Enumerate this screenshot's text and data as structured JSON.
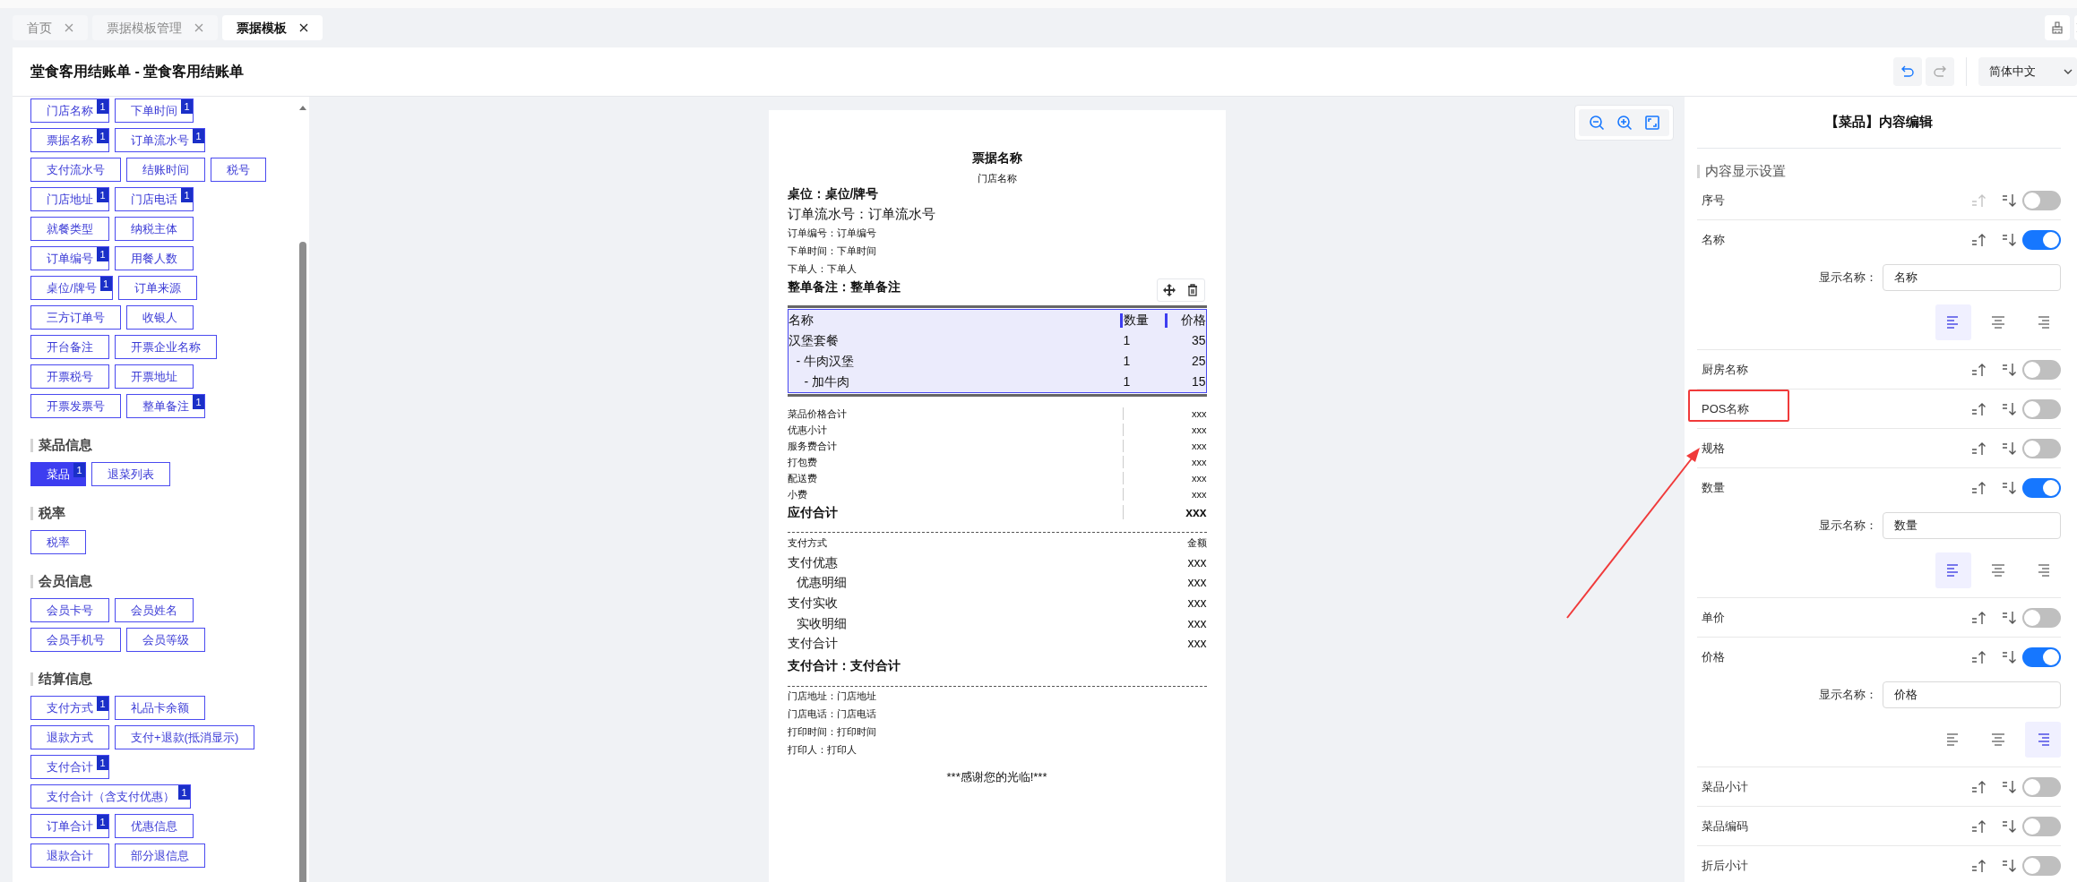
{
  "tabs": [
    {
      "label": "首页",
      "selected": false
    },
    {
      "label": "票据模板管理",
      "selected": false
    },
    {
      "label": "票据模板",
      "selected": true
    }
  ],
  "header": {
    "title": "堂食客用结账单 - 堂食客用结账单",
    "undo": {
      "disabled": false
    },
    "redo": {
      "disabled": true
    },
    "language": "简体中文"
  },
  "tag_groups": [
    {
      "rows": [
        [
          {
            "label": "门店名称",
            "badge": "1",
            "selected": false
          },
          {
            "label": "下单时间",
            "badge": "1",
            "selected": false
          }
        ],
        [
          {
            "label": "票据名称",
            "badge": "1",
            "selected": false
          },
          {
            "label": "订单流水号",
            "badge": "1",
            "selected": false
          }
        ],
        [
          {
            "label": "支付流水号",
            "selected": false
          },
          {
            "label": "结账时间",
            "selected": false
          },
          {
            "label": "税号",
            "selected": false
          }
        ],
        [
          {
            "label": "门店地址",
            "badge": "1",
            "selected": false
          },
          {
            "label": "门店电话",
            "badge": "1",
            "selected": false
          }
        ],
        [
          {
            "label": "就餐类型",
            "selected": false
          },
          {
            "label": "纳税主体",
            "selected": false
          }
        ],
        [
          {
            "label": "订单编号",
            "badge": "1",
            "selected": false
          },
          {
            "label": "用餐人数",
            "selected": false
          }
        ],
        [
          {
            "label": "桌位/牌号",
            "badge": "1",
            "selected": false
          },
          {
            "label": "订单来源",
            "selected": false
          }
        ],
        [
          {
            "label": "三方订单号",
            "selected": false
          },
          {
            "label": "收银人",
            "selected": false
          }
        ],
        [
          {
            "label": "开台备注",
            "selected": false
          },
          {
            "label": "开票企业名称",
            "selected": false
          }
        ],
        [
          {
            "label": "开票税号",
            "selected": false
          },
          {
            "label": "开票地址",
            "selected": false
          }
        ],
        [
          {
            "label": "开票发票号",
            "selected": false
          },
          {
            "label": "整单备注",
            "badge": "1",
            "selected": false
          }
        ]
      ]
    },
    {
      "title": "菜品信息",
      "rows": [
        [
          {
            "label": "菜品",
            "badge": "1",
            "selected": true
          },
          {
            "label": "退菜列表",
            "selected": false
          }
        ]
      ]
    },
    {
      "title": "税率",
      "rows": [
        [
          {
            "label": "税率",
            "selected": false
          }
        ]
      ]
    },
    {
      "title": "会员信息",
      "rows": [
        [
          {
            "label": "会员卡号",
            "selected": false
          },
          {
            "label": "会员姓名",
            "selected": false
          }
        ],
        [
          {
            "label": "会员手机号",
            "selected": false
          },
          {
            "label": "会员等级",
            "selected": false
          }
        ]
      ]
    },
    {
      "title": "结算信息",
      "rows": [
        [
          {
            "label": "支付方式",
            "badge": "1",
            "selected": false
          },
          {
            "label": "礼品卡余额",
            "selected": false
          }
        ],
        [
          {
            "label": "退款方式",
            "selected": false
          },
          {
            "label": "支付+退款(抵消显示)",
            "selected": false
          }
        ],
        [
          {
            "label": "支付合计",
            "badge": "1",
            "selected": false
          }
        ],
        [
          {
            "label": "支付合计（含支付优惠）",
            "badge": "1",
            "selected": false
          }
        ],
        [
          {
            "label": "订单合计",
            "badge": "1",
            "selected": false
          },
          {
            "label": "优惠信息",
            "selected": false
          }
        ],
        [
          {
            "label": "退款合计",
            "selected": false
          },
          {
            "label": "部分退信息",
            "selected": false
          }
        ]
      ]
    }
  ],
  "receipt": {
    "title": "票据名称",
    "store_name": "门店名称",
    "header_lines": [
      {
        "text": "桌位：桌位/牌号",
        "kind": "bold"
      },
      {
        "text": "订单流水号：订单流水号",
        "kind": "large"
      },
      {
        "text": "订单编号：订单编号",
        "kind": "small"
      },
      {
        "text": "下单时间：下单时间",
        "kind": "small"
      },
      {
        "text": "下单人：下单人",
        "kind": "small"
      },
      {
        "text": "整单备注：整单备注",
        "kind": "bold"
      }
    ],
    "dish_table": {
      "selected": true,
      "columns": [
        "名称",
        "数量",
        "价格"
      ],
      "rows": [
        {
          "name": "汉堡套餐",
          "qty": "1",
          "price": "35",
          "children": [
            {
              "name": "- 牛肉汉堡",
              "qty": "1",
              "price": "25",
              "children": [
                {
                  "name": "- 加牛肉",
                  "qty": "1",
                  "price": "15"
                }
              ]
            }
          ]
        }
      ]
    },
    "summary": [
      {
        "label": "菜品价格合计",
        "value": "xxx",
        "kind": "item"
      },
      {
        "label": "优惠小计",
        "value": "xxx",
        "kind": "item"
      },
      {
        "label": "服务费合计",
        "value": "xxx",
        "kind": "item"
      },
      {
        "label": "打包费",
        "value": "xxx",
        "kind": "item"
      },
      {
        "label": "配送费",
        "value": "xxx",
        "kind": "item"
      },
      {
        "label": "小费",
        "value": "xxx",
        "kind": "item"
      },
      {
        "label": "应付合计",
        "value": "xxx",
        "kind": "total"
      }
    ],
    "payment_header": {
      "label": "支付方式",
      "value": "金额"
    },
    "payments": [
      {
        "label": "支付优惠",
        "value": "xxx",
        "kind": "main"
      },
      {
        "label": "优惠明细",
        "value": "xxx",
        "kind": "detail"
      },
      {
        "label": "支付实收",
        "value": "xxx",
        "kind": "main"
      },
      {
        "label": "实收明细",
        "value": "xxx",
        "kind": "detail"
      },
      {
        "label": "支付合计",
        "value": "xxx",
        "kind": "main"
      }
    ],
    "payment_total": "支付合计：支付合计",
    "footer_lines": [
      "门店地址：门店地址",
      "门店电话：门店电话",
      "打印时间：打印时间",
      "打印人：打印人"
    ],
    "thanks": "***感谢您的光临!***"
  },
  "editor": {
    "title": "【菜品】内容编辑",
    "section": "内容显示设置",
    "items": [
      {
        "label": "序号",
        "on": false,
        "up_disabled": true,
        "annotated": false
      },
      {
        "label": "名称",
        "on": true,
        "up_disabled": false,
        "annotated": false,
        "display_label": "显示名称：",
        "display_name": "名称",
        "alignment": [
          {
            "kind": "left",
            "selected": true
          },
          {
            "kind": "center",
            "selected": false
          },
          {
            "kind": "right",
            "selected": false
          }
        ]
      },
      {
        "label": "厨房名称",
        "on": false,
        "up_disabled": false,
        "annotated": false
      },
      {
        "label": "POS名称",
        "on": false,
        "up_disabled": false,
        "annotated": true
      },
      {
        "label": "规格",
        "on": false,
        "up_disabled": false,
        "annotated": false
      },
      {
        "label": "数量",
        "on": true,
        "up_disabled": false,
        "annotated": false,
        "display_label": "显示名称：",
        "display_name": "数量",
        "alignment": [
          {
            "kind": "left",
            "selected": true
          },
          {
            "kind": "center",
            "selected": false
          },
          {
            "kind": "right",
            "selected": false
          }
        ]
      },
      {
        "label": "单价",
        "on": false,
        "up_disabled": false,
        "annotated": false
      },
      {
        "label": "价格",
        "on": true,
        "up_disabled": false,
        "annotated": false,
        "display_label": "显示名称：",
        "display_name": "价格",
        "alignment": [
          {
            "kind": "left",
            "selected": false
          },
          {
            "kind": "center",
            "selected": false
          },
          {
            "kind": "right",
            "selected": true
          }
        ]
      },
      {
        "label": "菜品小计",
        "on": false,
        "up_disabled": false,
        "annotated": false
      },
      {
        "label": "菜品编码",
        "on": false,
        "up_disabled": false,
        "annotated": false
      },
      {
        "label": "折后小计",
        "on": false,
        "up_disabled": false,
        "annotated": false
      }
    ]
  }
}
